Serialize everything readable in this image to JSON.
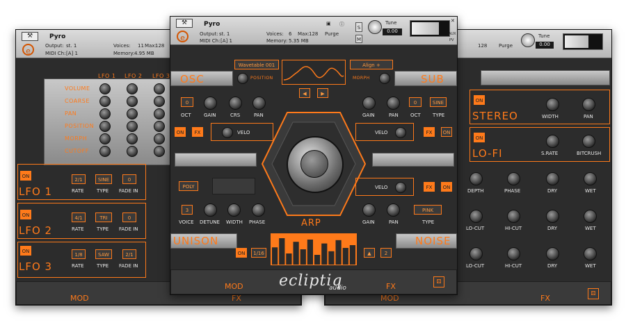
{
  "app": {
    "instrument_name": "Pyro",
    "output_label": "Output:",
    "output_value": "st. 1",
    "midi_label": "MIDI Ch:",
    "midi_value": "[A] 1",
    "voices_label": "Voices:",
    "voices_value": "6",
    "max_label": "Max:",
    "max_value": "128",
    "memory_label": "Memory:",
    "memory_value": "5.35 MB",
    "purge_label": "Purge",
    "tune_label": "Tune",
    "tune_value": "0.00",
    "aux_label": "AUX",
    "s_label": "S",
    "m_label": "M",
    "pv_label": "PV"
  },
  "left_panel": {
    "instrument_name": "Pyro",
    "voices_value": "11",
    "memory_value": "4.95 MB",
    "lfo_headers": [
      "LFO 1",
      "LFO 2",
      "LFO 3"
    ],
    "mod_rows": [
      "VOLUME",
      "COARSE",
      "PAN",
      "POSITION",
      "MORPH",
      "CUTOFF"
    ],
    "lfos": [
      {
        "title": "LFO 1",
        "rate": "2/1",
        "type": "SINE",
        "fade": "0"
      },
      {
        "title": "LFO 2",
        "rate": "4/1",
        "type": "TRI",
        "fade": "0"
      },
      {
        "title": "LFO 3",
        "rate": "1/8",
        "type": "SAW",
        "fade": "2/1"
      }
    ],
    "on_label": "ON",
    "rate_label": "RATE",
    "type_label": "TYPE",
    "fade_label": "FADE IN",
    "footer_mod": "MOD",
    "footer_fx": "FX"
  },
  "center_panel": {
    "osc_title": "OSC",
    "sub_title": "SUB",
    "wavetable_name": "Wavetable 001",
    "position_label": "POSITION",
    "morph_name": "Align +",
    "morph_label": "MORPH",
    "osc_oct_value": "0",
    "oct_label": "OCT",
    "gain_label": "GAIN",
    "crs_label": "CRS",
    "pan_label": "PAN",
    "sub_oct_value": "0",
    "sub_type_value": "SINE",
    "type_label": "TYPE",
    "on_label": "ON",
    "fx_label": "FX",
    "velo_label": "VELO",
    "poly_label": "POLY",
    "voice_value": "3",
    "voice_label": "VOICE",
    "detune_label": "DETUNE",
    "width_label": "WIDTH",
    "phase_label": "PHASE",
    "noise_type_value": "PINK",
    "arp_label": "ARP",
    "unison_title": "UNISON",
    "noise_title": "NOISE",
    "arp_rate": "1/16",
    "arp_steps": "2",
    "arp_pattern": [
      0.62,
      0.95,
      0.4,
      0.82,
      0.55,
      0.9,
      0.35,
      0.76,
      0.48,
      0.88,
      0.6,
      0.7
    ],
    "footer_mod": "MOD",
    "footer_fx": "FX",
    "brand": "ecliptiq",
    "brand_sub": "audio"
  },
  "right_panel": {
    "stereo_title": "STEREO",
    "lofi_title": "LO-FI",
    "on_label": "ON",
    "width_label": "WIDTH",
    "pan_label": "PAN",
    "srate_label": "S.RATE",
    "bitcrush_label": "BITCRUSH",
    "depth_label": "DEPTH",
    "phase_label": "PHASE",
    "dry_label": "DRY",
    "wet_label": "WET",
    "locut_label": "LO-CUT",
    "hicut_label": "HI-CUT",
    "voices_value": "128",
    "purge_label": "Purge",
    "tune_label": "Tune",
    "tune_value": "0.00",
    "footer_mod": "MOD",
    "footer_fx": "FX"
  },
  "colors": {
    "accent": "#ff7a1a",
    "panel": "#2c2c2c",
    "header": "#c8c8c8"
  }
}
